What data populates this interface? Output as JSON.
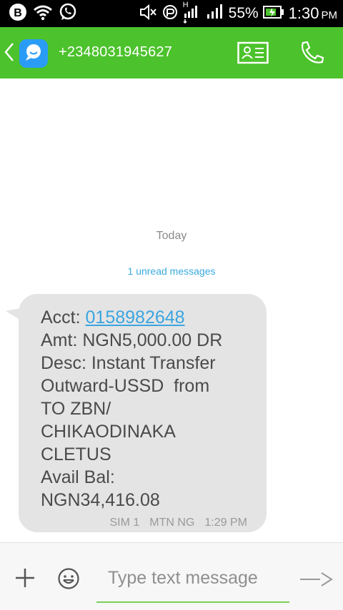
{
  "status_bar": {
    "battery_percent": "55%",
    "time": "1:30",
    "ampm": "PM",
    "network_type": "H",
    "icons": [
      "b-app-icon",
      "wifi-icon",
      "whatsapp-icon",
      "mute-icon",
      "data-saver-icon",
      "signal-sim1-icon",
      "signal-sim2-icon",
      "battery-charging-icon"
    ]
  },
  "header": {
    "contact_number": "+2348031945627",
    "accent_color": "#4cc22c"
  },
  "conversation": {
    "day_separator": "Today",
    "unread_notice": "1 unread messages",
    "message": {
      "acct_label": "Acct: ",
      "acct_number": "0158982648",
      "lines": [
        "Amt: NGN5,000.00 DR",
        "Desc: Instant Transfer",
        "Outward-USSD  from",
        "TO ZBN/",
        "CHIKAODINAKA",
        "CLETUS",
        "Avail Bal:",
        "NGN34,416.08"
      ],
      "sim": "SIM 1",
      "carrier": "MTN NG",
      "time": "1:29 PM"
    }
  },
  "composer": {
    "placeholder": "Type text message",
    "value": ""
  }
}
